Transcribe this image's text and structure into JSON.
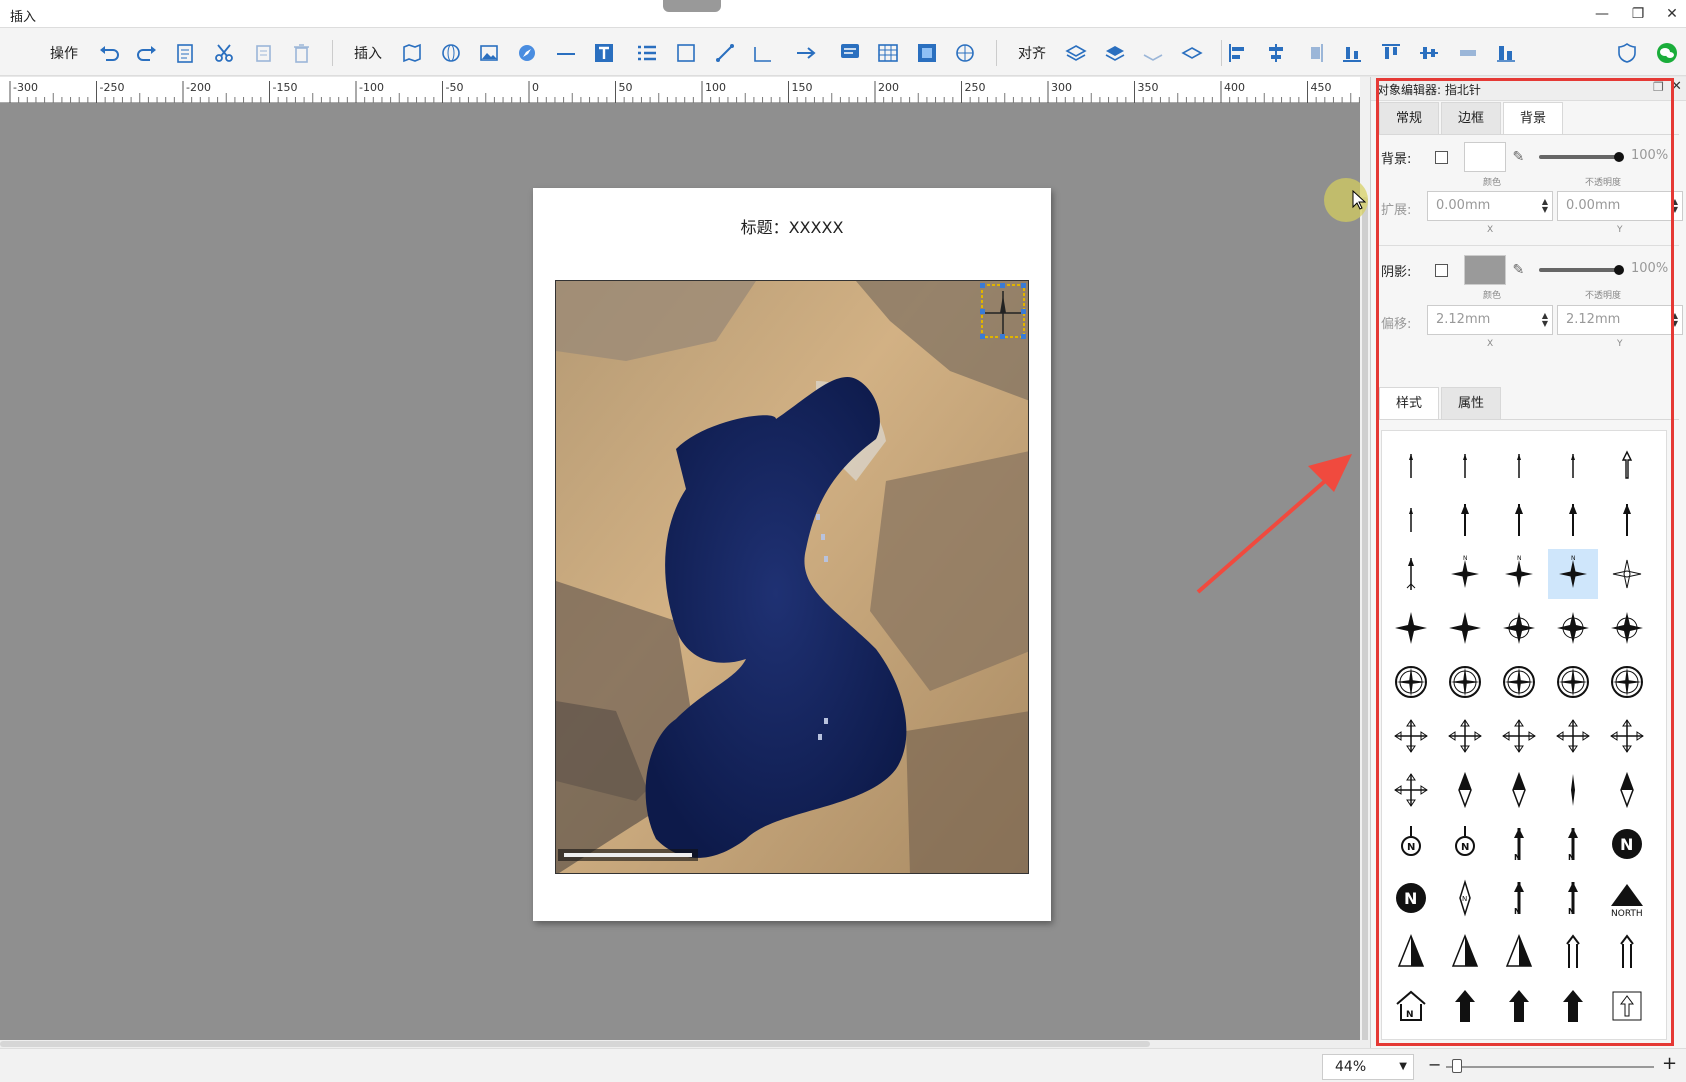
{
  "window": {
    "title": "插入"
  },
  "toolbar": {
    "ops_label": "操作",
    "insert_label": "插入",
    "align_label": "对齐"
  },
  "ruler": {
    "ticks": [
      "-300",
      "-250",
      "-200",
      "-150",
      "-100",
      "-50",
      "0",
      "50",
      "100",
      "150",
      "200",
      "250",
      "300",
      "350",
      "400",
      "450"
    ]
  },
  "page": {
    "title": "标题：XXXXX"
  },
  "panel": {
    "header": "对象编辑器: 指北针",
    "tabs": [
      {
        "label": "常规"
      },
      {
        "label": "边框"
      },
      {
        "label": "背景",
        "active": true
      }
    ],
    "background": {
      "label": "背景:",
      "color_caption": "颜色",
      "opacity": "100%",
      "opacity_caption": "不透明度",
      "extend_label": "扩展:",
      "extend_x": "0.00mm",
      "extend_y": "0.00mm",
      "x_caption": "X",
      "y_caption": "Y"
    },
    "shadow": {
      "label": "阴影:",
      "color_caption": "颜色",
      "opacity": "100%",
      "opacity_caption": "不透明度",
      "offset_label": "偏移:",
      "offset_x": "2.12mm",
      "offset_y": "2.12mm",
      "x_caption": "X",
      "y_caption": "Y"
    },
    "sub_tabs": [
      {
        "label": "样式",
        "active": true
      },
      {
        "label": "属性"
      }
    ],
    "gallery_text": {
      "north_label": "NORTH"
    }
  },
  "status": {
    "zoom": "44%",
    "minus": "−",
    "plus": "+"
  }
}
